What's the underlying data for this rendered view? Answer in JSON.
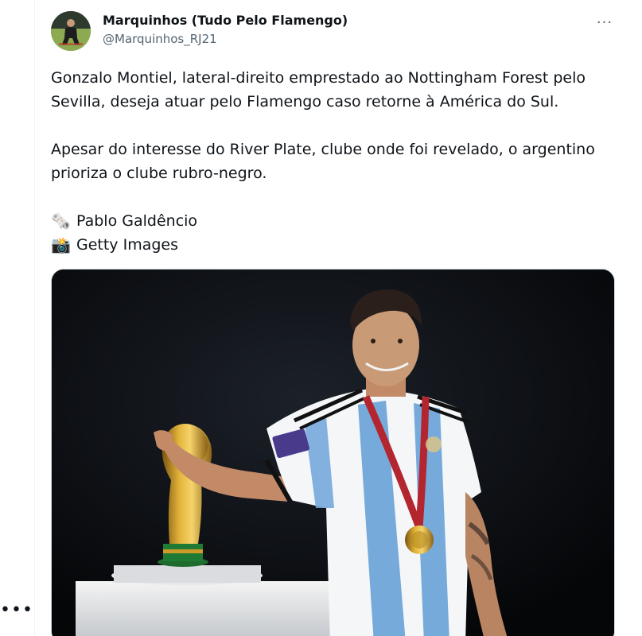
{
  "tweet": {
    "author": {
      "display_name": "Marquinhos (Tudo Pelo Flamengo)",
      "handle": "@Marquinhos_RJ21"
    },
    "more_label": "···",
    "paragraphs": [
      "Gonzalo Montiel, lateral-direito emprestado ao Nottingham Forest pelo Sevilla, deseja atuar pelo Flamengo caso retorne à América do Sul.",
      "Apesar do interesse do River Plate, clube onde foi revelado, o argentino prioriza o clube rubro-negro."
    ],
    "credits": [
      {
        "icon": "newspaper-icon",
        "glyph": "🗞️",
        "text": "Pablo Galdêncio"
      },
      {
        "icon": "camera-flash-icon",
        "glyph": "📸",
        "text": "Getty Images"
      }
    ],
    "media": {
      "type": "photo",
      "subject": "player-with-world-cup-trophy"
    }
  },
  "left_rail": {
    "more_label": "•••"
  },
  "colors": {
    "text_primary": "#0f1419",
    "text_secondary": "#536471",
    "border": "#cfd9de",
    "argentina_blue": "#75aadb",
    "trophy_gold": "#d4a017"
  }
}
